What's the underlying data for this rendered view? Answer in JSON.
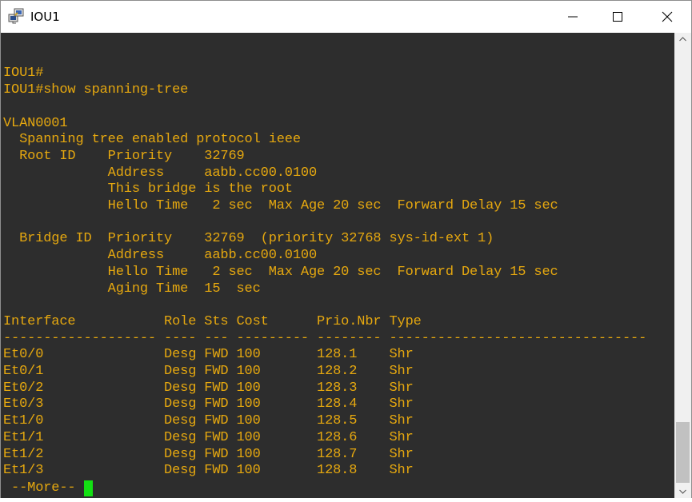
{
  "window": {
    "title": "IOU1"
  },
  "icons": {
    "app": "network-putty-icon",
    "minimize": "minimize-icon",
    "maximize": "maximize-icon",
    "close": "close-icon",
    "scroll_up": "scroll-up-arrow-icon",
    "scroll_down": "scroll-down-arrow-icon"
  },
  "colors": {
    "terminal_bg": "#2d2d2d",
    "terminal_fg": "#e6a80f",
    "cursor": "#13e013"
  },
  "terminal": {
    "lines": [
      "",
      "",
      "IOU1#",
      "IOU1#show spanning-tree",
      "",
      "VLAN0001",
      "  Spanning tree enabled protocol ieee",
      "  Root ID    Priority    32769",
      "             Address     aabb.cc00.0100",
      "             This bridge is the root",
      "             Hello Time   2 sec  Max Age 20 sec  Forward Delay 15 sec",
      "",
      "  Bridge ID  Priority    32769  (priority 32768 sys-id-ext 1)",
      "             Address     aabb.cc00.0100",
      "             Hello Time   2 sec  Max Age 20 sec  Forward Delay 15 sec",
      "             Aging Time  15  sec",
      "",
      "Interface           Role Sts Cost      Prio.Nbr Type",
      "------------------- ---- --- --------- -------- --------------------------------",
      "Et0/0               Desg FWD 100       128.1    Shr",
      "Et0/1               Desg FWD 100       128.2    Shr",
      "Et0/2               Desg FWD 100       128.3    Shr",
      "Et0/3               Desg FWD 100       128.4    Shr",
      "Et1/0               Desg FWD 100       128.5    Shr",
      "Et1/1               Desg FWD 100       128.6    Shr",
      "Et1/2               Desg FWD 100       128.7    Shr",
      "Et1/3               Desg FWD 100       128.8    Shr"
    ],
    "more_prompt": " --More-- "
  }
}
